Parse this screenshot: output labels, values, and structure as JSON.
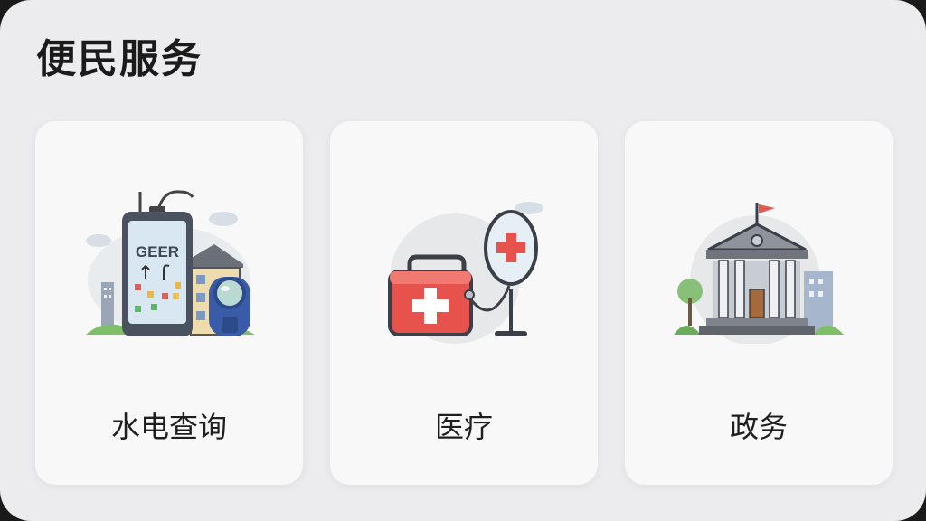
{
  "section": {
    "title": "便民服务"
  },
  "cards": [
    {
      "label": "水电查询",
      "icon": "utility-meter-icon",
      "screen_text": "GEER"
    },
    {
      "label": "医疗",
      "icon": "medical-kit-icon"
    },
    {
      "label": "政务",
      "icon": "government-building-icon"
    }
  ],
  "colors": {
    "panel_bg": "#ececee",
    "card_bg": "#f8f8f8",
    "medical_red": "#e8524c",
    "flag_red": "#e05a4f"
  }
}
